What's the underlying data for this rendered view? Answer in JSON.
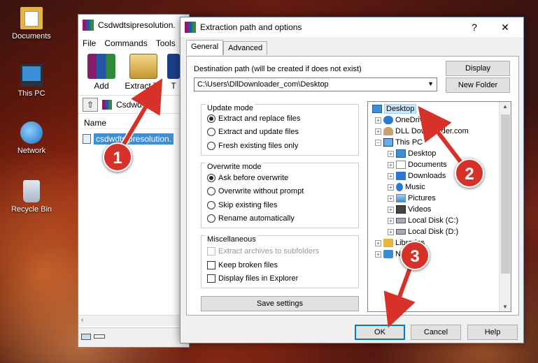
{
  "desktop": {
    "icons": [
      {
        "label": "Documents"
      },
      {
        "label": "This PC"
      },
      {
        "label": "Network"
      },
      {
        "label": "Recycle Bin"
      }
    ]
  },
  "winrar": {
    "title": "Csdwdtsipresolution.",
    "menu": [
      "File",
      "Commands",
      "Tools"
    ],
    "toolbar": {
      "add": "Add",
      "extract": "Extract To",
      "partial": "T"
    },
    "address": "Csdwdtsipr",
    "column_header": "Name",
    "file_name": "csdwdtsipresolution."
  },
  "dialog": {
    "title": "Extraction path and options",
    "help_glyph": "?",
    "close_glyph": "✕",
    "tabs": [
      "General",
      "Advanced"
    ],
    "dest_label": "Destination path (will be created if does not exist)",
    "dest_value": "C:\\Users\\DllDownloader_com\\Desktop",
    "display_button": "Display",
    "new_folder_button": "New Folder",
    "update_mode": {
      "title": "Update mode",
      "options": [
        "Extract and replace files",
        "Extract and update files",
        "Fresh existing files only"
      ],
      "selected": 0
    },
    "overwrite_mode": {
      "title": "Overwrite mode",
      "options": [
        "Ask before overwrite",
        "Overwrite without prompt",
        "Skip existing files",
        "Rename automatically"
      ],
      "selected": 0
    },
    "misc": {
      "title": "Miscellaneous",
      "options": [
        "Extract archives to subfolders",
        "Keep broken files",
        "Display files in Explorer"
      ]
    },
    "save_settings": "Save settings",
    "tree": [
      {
        "label": "Desktop",
        "icon": "desktop-icon",
        "selected": true
      },
      {
        "label": "OneDrive",
        "icon": "cloud-icon"
      },
      {
        "label": "DLL Downloader.com",
        "icon": "user-icon"
      },
      {
        "label": "This PC",
        "icon": "pc-icon"
      },
      {
        "label": "Desktop",
        "icon": "desktop-icon"
      },
      {
        "label": "Documents",
        "icon": "document-icon"
      },
      {
        "label": "Downloads",
        "icon": "download-icon"
      },
      {
        "label": "Music",
        "icon": "music-icon"
      },
      {
        "label": "Pictures",
        "icon": "pictures-icon"
      },
      {
        "label": "Videos",
        "icon": "video-icon"
      },
      {
        "label": "Local Disk (C:)",
        "icon": "disk-icon"
      },
      {
        "label": "Local Disk (D:)",
        "icon": "disk-icon"
      },
      {
        "label": "Libraries",
        "icon": "library-icon"
      },
      {
        "label": "N",
        "icon": "network-icon"
      }
    ],
    "ok": "OK",
    "cancel": "Cancel",
    "help": "Help"
  },
  "annotations": [
    "1",
    "2",
    "3"
  ],
  "colors": {
    "annotation": "#d6322a",
    "accent": "#0078d7"
  }
}
